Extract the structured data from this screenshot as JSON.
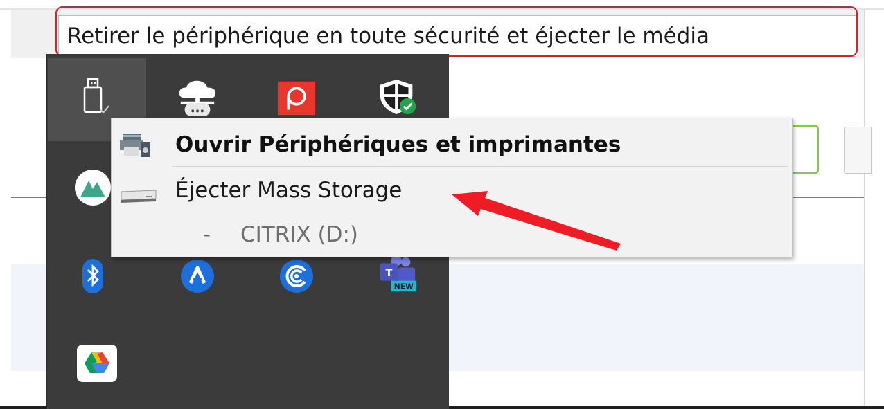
{
  "tooltip": {
    "text": "Retirer le périphérique en toute sécurité et éjecter le média"
  },
  "tray": {
    "icons": [
      {
        "name": "usb-safely-remove-icon"
      },
      {
        "name": "onedrive-cloud-icon"
      },
      {
        "name": "pocketcasts-p-icon"
      },
      {
        "name": "windows-security-shield-icon"
      },
      {
        "name": "nordvpn-icon"
      },
      {
        "name": "bluetooth-icon"
      },
      {
        "name": "anydesk-icon"
      },
      {
        "name": "citrix-workspace-icon"
      },
      {
        "name": "teams-new-icon"
      },
      {
        "name": "google-drive-icon"
      }
    ],
    "teams_badge": "NEW"
  },
  "context_menu": {
    "open_devices_label": "Ouvrir Périphériques et imprimantes",
    "eject_label": "Éjecter Mass Storage",
    "drive_dash": "-",
    "drive_label": "CITRIX (D:)"
  },
  "colors": {
    "highlight_red": "#e11d2a",
    "tray_bg": "#3b3b3b",
    "menu_bg": "#f2f2f2"
  }
}
